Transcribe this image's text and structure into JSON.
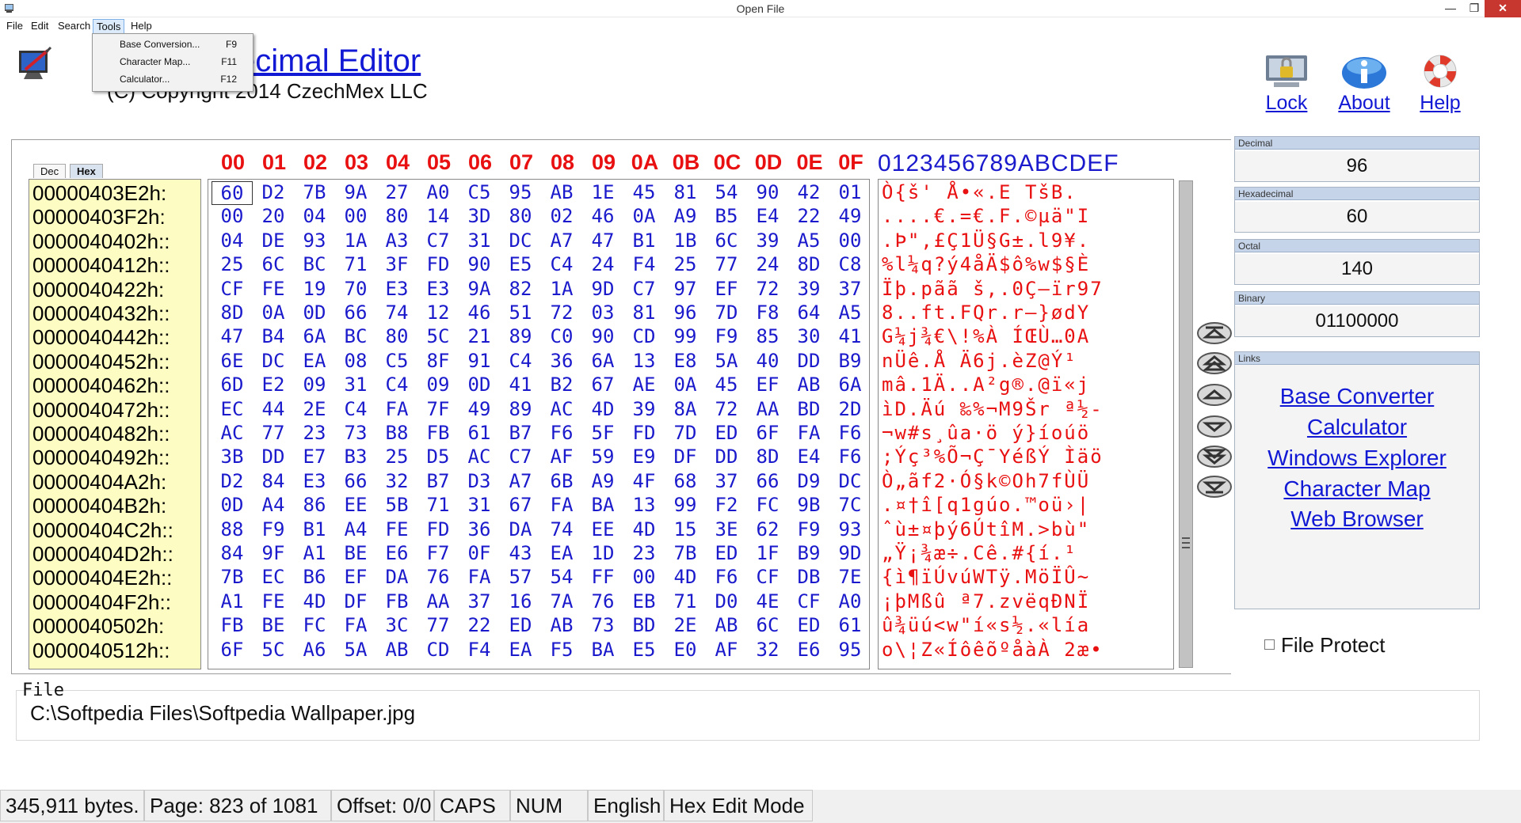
{
  "window": {
    "title": "Open File",
    "minimize_glyph": "—",
    "restore_glyph": "❐",
    "close_glyph": "✕"
  },
  "menubar": {
    "items": [
      "File",
      "Edit",
      "Search",
      "Tools",
      "Help"
    ],
    "active": "Tools"
  },
  "tools_menu": [
    {
      "label": "Base Conversion...",
      "shortcut": "F9"
    },
    {
      "label": "Character Map...",
      "shortcut": "F11"
    },
    {
      "label": "Calculator...",
      "shortcut": "F12"
    }
  ],
  "header": {
    "title_visible": "ecimal Editor",
    "copyright_visible": "(C) Copyright 2014 CzechMex LLC"
  },
  "top_buttons": {
    "lock": "Lock",
    "about": "About",
    "help": "Help"
  },
  "view_tabs": {
    "dec": "Dec",
    "hex": "Hex",
    "selected": "Hex"
  },
  "column_headers": [
    "00",
    "01",
    "02",
    "03",
    "04",
    "05",
    "06",
    "07",
    "08",
    "09",
    "0A",
    "0B",
    "0C",
    "0D",
    "0E",
    "0F"
  ],
  "char_header": "0123456789ABCDEF",
  "addresses": [
    "00000403E2h:",
    "00000403F2h:",
    "0000040402h::",
    "0000040412h::",
    "0000040422h:",
    "0000040432h::",
    "0000040442h::",
    "0000040452h::",
    "0000040462h::",
    "0000040472h::",
    "0000040482h::",
    "0000040492h::",
    "00000404A2h:",
    "00000404B2h:",
    "00000404C2h::",
    "00000404D2h::",
    "00000404E2h::",
    "00000404F2h::",
    "0000040502h:",
    "0000040512h::"
  ],
  "hex_rows": [
    [
      "60",
      "D2",
      "7B",
      "9A",
      "27",
      "A0",
      "C5",
      "95",
      "AB",
      "1E",
      "45",
      "81",
      "54",
      "90",
      "42",
      "01"
    ],
    [
      "00",
      "20",
      "04",
      "00",
      "80",
      "14",
      "3D",
      "80",
      "02",
      "46",
      "0A",
      "A9",
      "B5",
      "E4",
      "22",
      "49"
    ],
    [
      "04",
      "DE",
      "93",
      "1A",
      "A3",
      "C7",
      "31",
      "DC",
      "A7",
      "47",
      "B1",
      "1B",
      "6C",
      "39",
      "A5",
      "00"
    ],
    [
      "25",
      "6C",
      "BC",
      "71",
      "3F",
      "FD",
      "90",
      "E5",
      "C4",
      "24",
      "F4",
      "25",
      "77",
      "24",
      "8D",
      "C8"
    ],
    [
      "CF",
      "FE",
      "19",
      "70",
      "E3",
      "E3",
      "9A",
      "82",
      "1A",
      "9D",
      "C7",
      "97",
      "EF",
      "72",
      "39",
      "37"
    ],
    [
      "8D",
      "0A",
      "0D",
      "66",
      "74",
      "12",
      "46",
      "51",
      "72",
      "03",
      "81",
      "96",
      "7D",
      "F8",
      "64",
      "A5"
    ],
    [
      "47",
      "B4",
      "6A",
      "BC",
      "80",
      "5C",
      "21",
      "89",
      "C0",
      "90",
      "CD",
      "99",
      "F9",
      "85",
      "30",
      "41"
    ],
    [
      "6E",
      "DC",
      "EA",
      "08",
      "C5",
      "8F",
      "91",
      "C4",
      "36",
      "6A",
      "13",
      "E8",
      "5A",
      "40",
      "DD",
      "B9"
    ],
    [
      "6D",
      "E2",
      "09",
      "31",
      "C4",
      "09",
      "0D",
      "41",
      "B2",
      "67",
      "AE",
      "0A",
      "45",
      "EF",
      "AB",
      "6A"
    ],
    [
      "EC",
      "44",
      "2E",
      "C4",
      "FA",
      "7F",
      "49",
      "89",
      "AC",
      "4D",
      "39",
      "8A",
      "72",
      "AA",
      "BD",
      "2D"
    ],
    [
      "AC",
      "77",
      "23",
      "73",
      "B8",
      "FB",
      "61",
      "B7",
      "F6",
      "5F",
      "FD",
      "7D",
      "ED",
      "6F",
      "FA",
      "F6"
    ],
    [
      "3B",
      "DD",
      "E7",
      "B3",
      "25",
      "D5",
      "AC",
      "C7",
      "AF",
      "59",
      "E9",
      "DF",
      "DD",
      "8D",
      "E4",
      "F6"
    ],
    [
      "D2",
      "84",
      "E3",
      "66",
      "32",
      "B7",
      "D3",
      "A7",
      "6B",
      "A9",
      "4F",
      "68",
      "37",
      "66",
      "D9",
      "DC"
    ],
    [
      "0D",
      "A4",
      "86",
      "EE",
      "5B",
      "71",
      "31",
      "67",
      "FA",
      "BA",
      "13",
      "99",
      "F2",
      "FC",
      "9B",
      "7C"
    ],
    [
      "88",
      "F9",
      "B1",
      "A4",
      "FE",
      "FD",
      "36",
      "DA",
      "74",
      "EE",
      "4D",
      "15",
      "3E",
      "62",
      "F9",
      "93"
    ],
    [
      "84",
      "9F",
      "A1",
      "BE",
      "E6",
      "F7",
      "0F",
      "43",
      "EA",
      "1D",
      "23",
      "7B",
      "ED",
      "1F",
      "B9",
      "9D"
    ],
    [
      "7B",
      "EC",
      "B6",
      "EF",
      "DA",
      "76",
      "FA",
      "57",
      "54",
      "FF",
      "00",
      "4D",
      "F6",
      "CF",
      "DB",
      "7E"
    ],
    [
      "A1",
      "FE",
      "4D",
      "DF",
      "FB",
      "AA",
      "37",
      "16",
      "7A",
      "76",
      "EB",
      "71",
      "D0",
      "4E",
      "CF",
      "A0"
    ],
    [
      "FB",
      "BE",
      "FC",
      "FA",
      "3C",
      "77",
      "22",
      "ED",
      "AB",
      "73",
      "BD",
      "2E",
      "AB",
      "6C",
      "ED",
      "61"
    ],
    [
      "6F",
      "5C",
      "A6",
      "5A",
      "AB",
      "CD",
      "F4",
      "EA",
      "F5",
      "BA",
      "E5",
      "E0",
      "AF",
      "32",
      "E6",
      "95"
    ]
  ],
  "char_rows": [
    " Ò{š' Å•«.E TšB.",
    "....€.=€.F.©µä\"I",
    ".Þ\"‚£Ç1Ü§G±.l9¥.",
    "%l¼q?ý4åÄ$ô%w$§È",
    "Ïþ.pãã š,.0Ç–ïr97",
    "8..ft.FQr.r–}ødY",
    "G¼j¾€\\!%À ÍŒÙ…0A",
    "nÜê.Å Ä6j.èZ@Ý¹",
    "mâ.1Ä..A²g®.@ï«j",
    "ìD.Äú ‰%¬M9Šr ª½-",
    "¬w#s¸ûa·ö ý}íoúö",
    ";Ýç³%Õ¬Ç¯YéßÝ Ìäö",
    "Ò„ãf2·Ó§k©Oh7fÙÜ",
    ".¤†î[q1gúo.™oü›|",
    "ˆù±¤þý6ÚtîM.>bù\"",
    "„Ÿ¡¾æ÷.Cê.#{í.¹",
    "{ì¶ïÚvúWTÿ.MöÏÛ~",
    "¡þMßû ª7.zvëqÐNÏ ",
    "û¾üú<w\"í«s½.«lía",
    "o\\¦Z«ÍôêõºåàÀ 2æ•"
  ],
  "value_boxes": [
    {
      "title": "Decimal",
      "value": "96"
    },
    {
      "title": "Hexadecimal",
      "value": "60"
    },
    {
      "title": "Octal",
      "value": "140"
    },
    {
      "title": "Binary",
      "value": "01100000"
    }
  ],
  "links": {
    "title": "Links",
    "items": [
      "Base Converter",
      "Calculator",
      "Windows Explorer",
      "Character Map",
      "Web Browser"
    ]
  },
  "file_protect": "File Protect",
  "file": {
    "label": "File",
    "path": "C:\\Softpedia Files\\Softpedia Wallpaper.jpg"
  },
  "status": {
    "bytes": "345,911 bytes.",
    "page": "Page: 823  of  1081",
    "offset": "Offset: 0/0",
    "caps": "CAPS",
    "num": "NUM",
    "language": "English",
    "mode": "Hex Edit Mode"
  }
}
